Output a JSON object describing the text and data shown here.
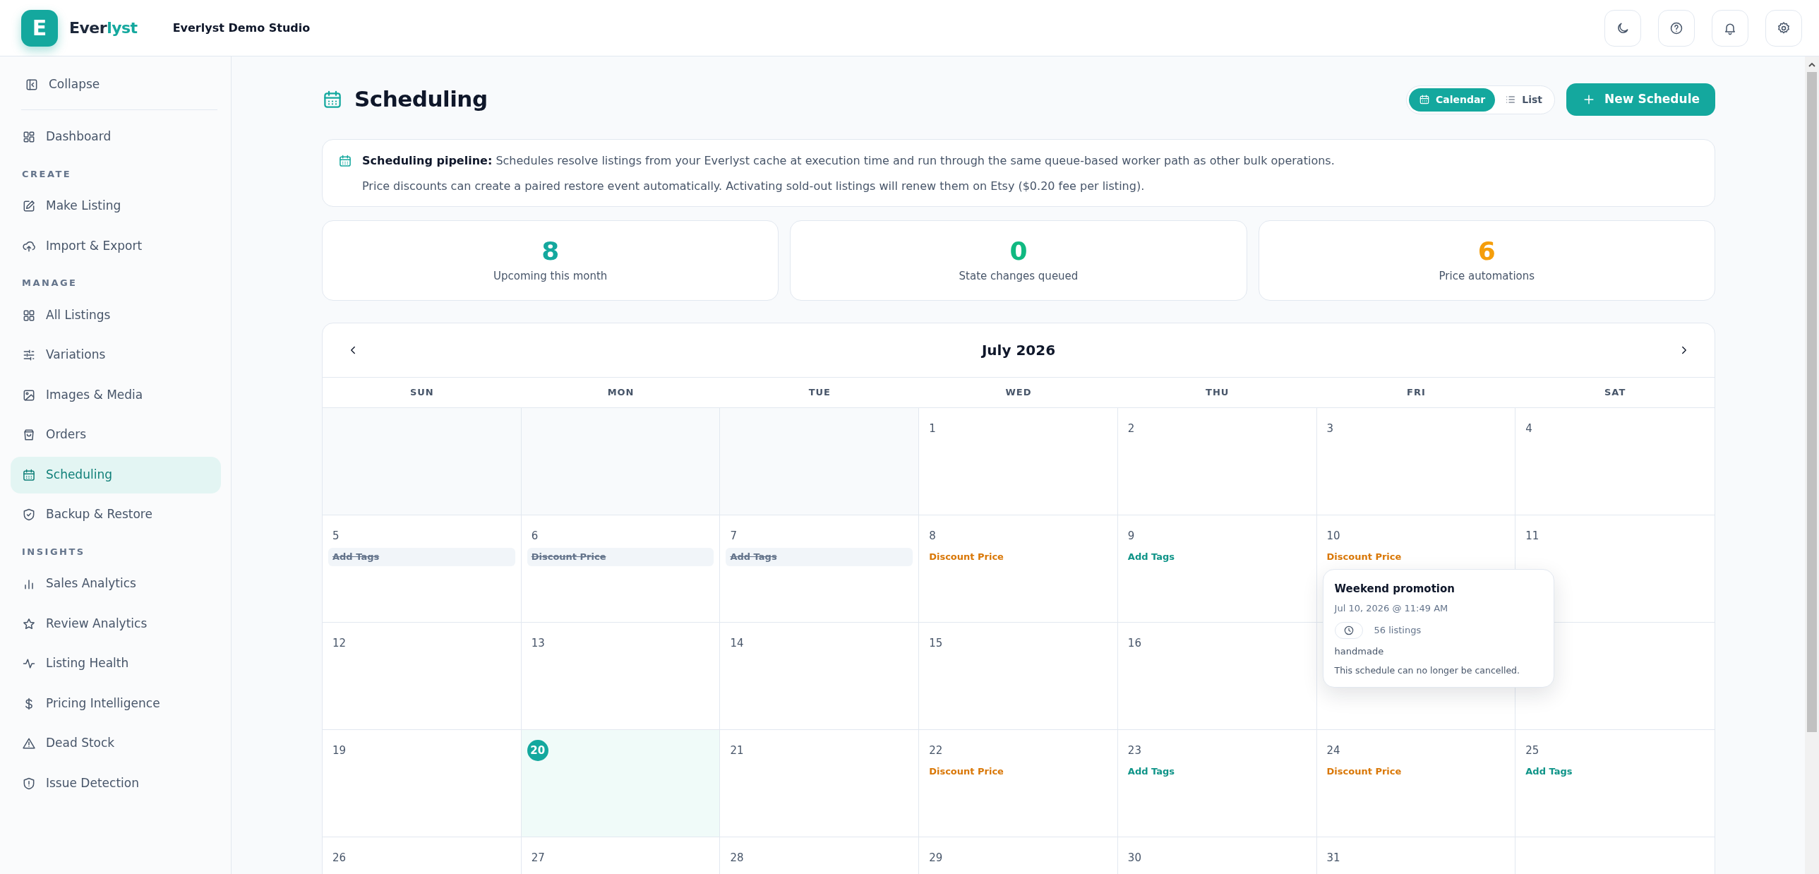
{
  "header": {
    "logo_letter": "E",
    "brand": [
      {
        "text": "Ever",
        "accent": false
      },
      {
        "text": "lyst",
        "accent": true
      }
    ],
    "workspace": "Everlyst Demo Studio"
  },
  "sidebar": {
    "collapse_label": "Collapse",
    "sections": [
      {
        "items": [
          {
            "label": "Dashboard",
            "selected": false
          }
        ]
      },
      {
        "heading": "CREATE",
        "items": [
          {
            "label": "Make Listing",
            "selected": false
          },
          {
            "label": "Import & Export",
            "selected": false
          }
        ]
      },
      {
        "heading": "MANAGE",
        "items": [
          {
            "label": "All Listings",
            "selected": false
          },
          {
            "label": "Variations",
            "selected": false
          },
          {
            "label": "Images & Media",
            "selected": false
          },
          {
            "label": "Orders",
            "selected": false
          },
          {
            "label": "Scheduling",
            "selected": true
          },
          {
            "label": "Backup & Restore",
            "selected": false
          }
        ]
      },
      {
        "heading": "INSIGHTS",
        "items": [
          {
            "label": "Sales Analytics",
            "selected": false
          },
          {
            "label": "Review Analytics",
            "selected": false
          },
          {
            "label": "Listing Health",
            "selected": false
          },
          {
            "label": "Pricing Intelligence",
            "selected": false
          },
          {
            "label": "Dead Stock",
            "selected": false
          },
          {
            "label": "Issue Detection",
            "selected": false
          }
        ]
      }
    ]
  },
  "page": {
    "title": "Scheduling",
    "view_toggle": [
      {
        "label": "Calendar",
        "selected": true
      },
      {
        "label": "List",
        "selected": false
      }
    ],
    "new_button": "New Schedule"
  },
  "info": {
    "lines": [
      "**Scheduling pipeline:** Schedules resolve listings from your Everlyst cache at execution time and run through the same queue-based worker path as other bulk operations.",
      "Price discounts can create a paired restore event automatically. Activating sold-out listings will renew them on Etsy ($0.20 fee per listing)."
    ]
  },
  "stats": [
    {
      "value": "8",
      "label": "Upcoming this month",
      "color": "#14a89e"
    },
    {
      "value": "0",
      "label": "State changes queued",
      "color": "#10b981"
    },
    {
      "value": "6",
      "label": "Price automations",
      "color": "#f59e0b"
    }
  ],
  "calendar": {
    "month": "July 2026",
    "weekdays": [
      "SUN",
      "MON",
      "TUE",
      "WED",
      "THU",
      "FRI",
      "SAT"
    ],
    "weeks": [
      [
        {
          "blank": true
        },
        {
          "blank": true
        },
        {
          "blank": true
        },
        {
          "day": "1",
          "today": false
        },
        {
          "day": "2",
          "today": false
        },
        {
          "day": "3",
          "today": false
        },
        {
          "day": "4",
          "today": false
        }
      ],
      [
        {
          "day": "5",
          "today": false,
          "events": [
            {
              "label": "Add Tags",
              "kind": "tags",
              "completed": true
            }
          ]
        },
        {
          "day": "6",
          "today": false,
          "events": [
            {
              "label": "Discount Price",
              "kind": "discount",
              "completed": true
            }
          ]
        },
        {
          "day": "7",
          "today": false,
          "events": [
            {
              "label": "Add Tags",
              "kind": "tags",
              "completed": true
            }
          ]
        },
        {
          "day": "8",
          "today": false,
          "events": [
            {
              "label": "Discount Price",
              "kind": "discount",
              "completed": false
            }
          ]
        },
        {
          "day": "9",
          "today": false,
          "events": [
            {
              "label": "Add Tags",
              "kind": "tags",
              "completed": false
            }
          ]
        },
        {
          "day": "10",
          "today": false,
          "events": [
            {
              "label": "Discount Price",
              "kind": "discount",
              "completed": false
            }
          ],
          "popover": {
            "title": "Weekend promotion",
            "when": "Jul 10, 2026 @ 11:49 AM",
            "count": "56 listings",
            "tag": "handmade",
            "note": "This schedule can no longer be cancelled."
          }
        },
        {
          "day": "11",
          "today": false
        }
      ],
      [
        {
          "day": "12",
          "today": false
        },
        {
          "day": "13",
          "today": false
        },
        {
          "day": "14",
          "today": false
        },
        {
          "day": "15",
          "today": false
        },
        {
          "day": "16",
          "today": false
        },
        {
          "blank": false
        },
        {
          "blank": false
        }
      ],
      [
        {
          "day": "19",
          "today": false
        },
        {
          "day": "20",
          "today": true
        },
        {
          "day": "21",
          "today": false
        },
        {
          "day": "22",
          "today": false,
          "events": [
            {
              "label": "Discount Price",
              "kind": "discount",
              "completed": false
            }
          ]
        },
        {
          "day": "23",
          "today": false,
          "events": [
            {
              "label": "Add Tags",
              "kind": "tags",
              "completed": false
            }
          ]
        },
        {
          "day": "24",
          "today": false,
          "events": [
            {
              "label": "Discount Price",
              "kind": "discount",
              "completed": false
            }
          ]
        },
        {
          "day": "25",
          "today": false,
          "events": [
            {
              "label": "Add Tags",
              "kind": "tags",
              "completed": false
            }
          ]
        }
      ],
      [
        {
          "day": "26",
          "today": false
        },
        {
          "day": "27",
          "today": false
        },
        {
          "day": "28",
          "today": false
        },
        {
          "day": "29",
          "today": false
        },
        {
          "day": "30",
          "today": false
        },
        {
          "day": "31",
          "today": false
        }
      ]
    ]
  }
}
